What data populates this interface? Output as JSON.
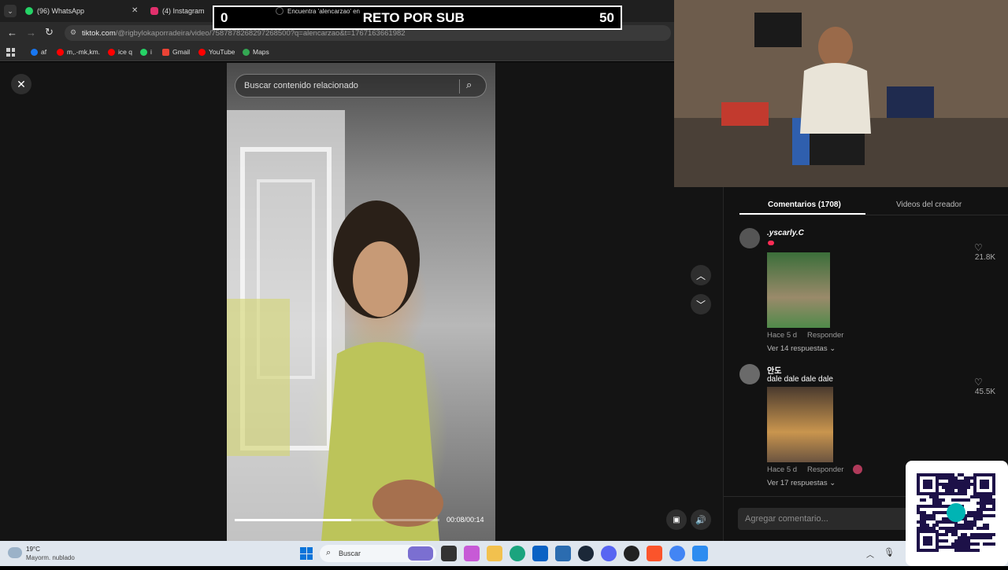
{
  "tabs": [
    {
      "label": "(96) WhatsApp"
    },
    {
      "label": "(4) Instagram"
    },
    {
      "label": "Encuentra 'alencarzao' en"
    }
  ],
  "address": {
    "host": "tiktok.com",
    "path": "/@rigbylokaporradeira/video/7587878268297268500?q=alencarzao&t=1767163661982"
  },
  "bookmarks": [
    {
      "label": "af",
      "color": "#1877f2"
    },
    {
      "label": "m,.-mk,km.",
      "color": "#ff0000"
    },
    {
      "label": "ice q",
      "color": "#ff0000"
    },
    {
      "label": "i",
      "color": "#25d366"
    },
    {
      "label": "Gmail",
      "color": "#ea4335"
    },
    {
      "label": "YouTube",
      "color": "#ff0000"
    },
    {
      "label": "Maps",
      "color": "#34a853"
    }
  ],
  "score": {
    "left": "0",
    "title": "RETO POR SUB",
    "right": "50"
  },
  "video": {
    "search_placeholder": "Buscar contenido relacionado",
    "timecode": "00:08/00:14",
    "progress": 0.57
  },
  "comments_panel": {
    "tab_comments": "Comentarios (1708)",
    "tab_videos": "Videos del creador",
    "comments": [
      {
        "name": ".yscarly.C",
        "text": "",
        "likes": "21.8K",
        "meta_time": "Hace 5 d",
        "reply": "Responder",
        "replies": "Ver 14 respuestas"
      },
      {
        "name": "안도",
        "text": "dale dale dale dale",
        "likes": "45.5K",
        "meta_time": "Hace 5 d",
        "reply": "Responder",
        "replies": "Ver 17 respuestas"
      }
    ],
    "input_placeholder": "Agregar comentario..."
  },
  "taskbar": {
    "weather_temp": "19°C",
    "weather_desc": "Mayorm. nublado",
    "search_label": "Buscar"
  },
  "colors": {
    "accent": "#fe2c55",
    "qr_brand": "#00b4b4"
  }
}
